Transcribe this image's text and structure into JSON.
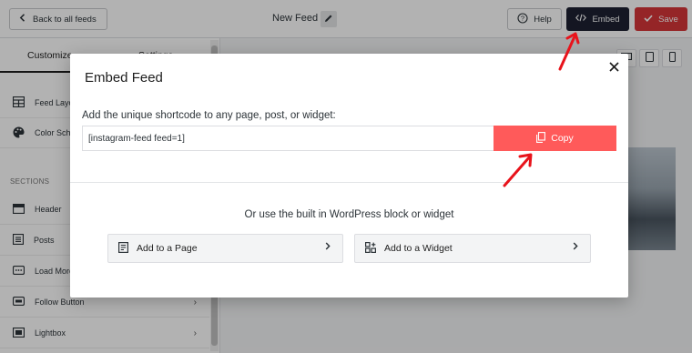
{
  "topbar": {
    "back_label": "Back to all feeds",
    "feed_name": "New Feed",
    "help_label": "Help",
    "embed_label": "Embed",
    "save_label": "Save"
  },
  "sidebar": {
    "tabs": [
      {
        "label": "Customize",
        "active": true
      },
      {
        "label": "Settings",
        "active": false
      }
    ],
    "top_items": [
      {
        "label": "Feed Layout",
        "icon": "table-icon"
      },
      {
        "label": "Color Scheme",
        "icon": "palette-icon"
      }
    ],
    "section_label": "SECTIONS",
    "section_items": [
      {
        "label": "Header",
        "icon": "header-icon",
        "has_chevron": false
      },
      {
        "label": "Posts",
        "icon": "posts-icon",
        "has_chevron": false
      },
      {
        "label": "Load More Button",
        "icon": "load-more-icon",
        "has_chevron": false
      },
      {
        "label": "Follow Button",
        "icon": "follow-icon",
        "has_chevron": true
      },
      {
        "label": "Lightbox",
        "icon": "lightbox-icon",
        "has_chevron": true
      }
    ]
  },
  "modal": {
    "title": "Embed Feed",
    "shortcode_label": "Add the unique shortcode to any page, post, or widget:",
    "shortcode_value": "[instagram-feed feed=1]",
    "copy_label": "Copy",
    "or_text": "Or use the built in WordPress block or widget",
    "add_page_label": "Add to a Page",
    "add_widget_label": "Add to a Widget"
  },
  "colors": {
    "embed_button": "#1d2031",
    "save_button": "#d63638",
    "copy_button": "#ff5a5a",
    "annotation_arrow": "#e8131b"
  }
}
